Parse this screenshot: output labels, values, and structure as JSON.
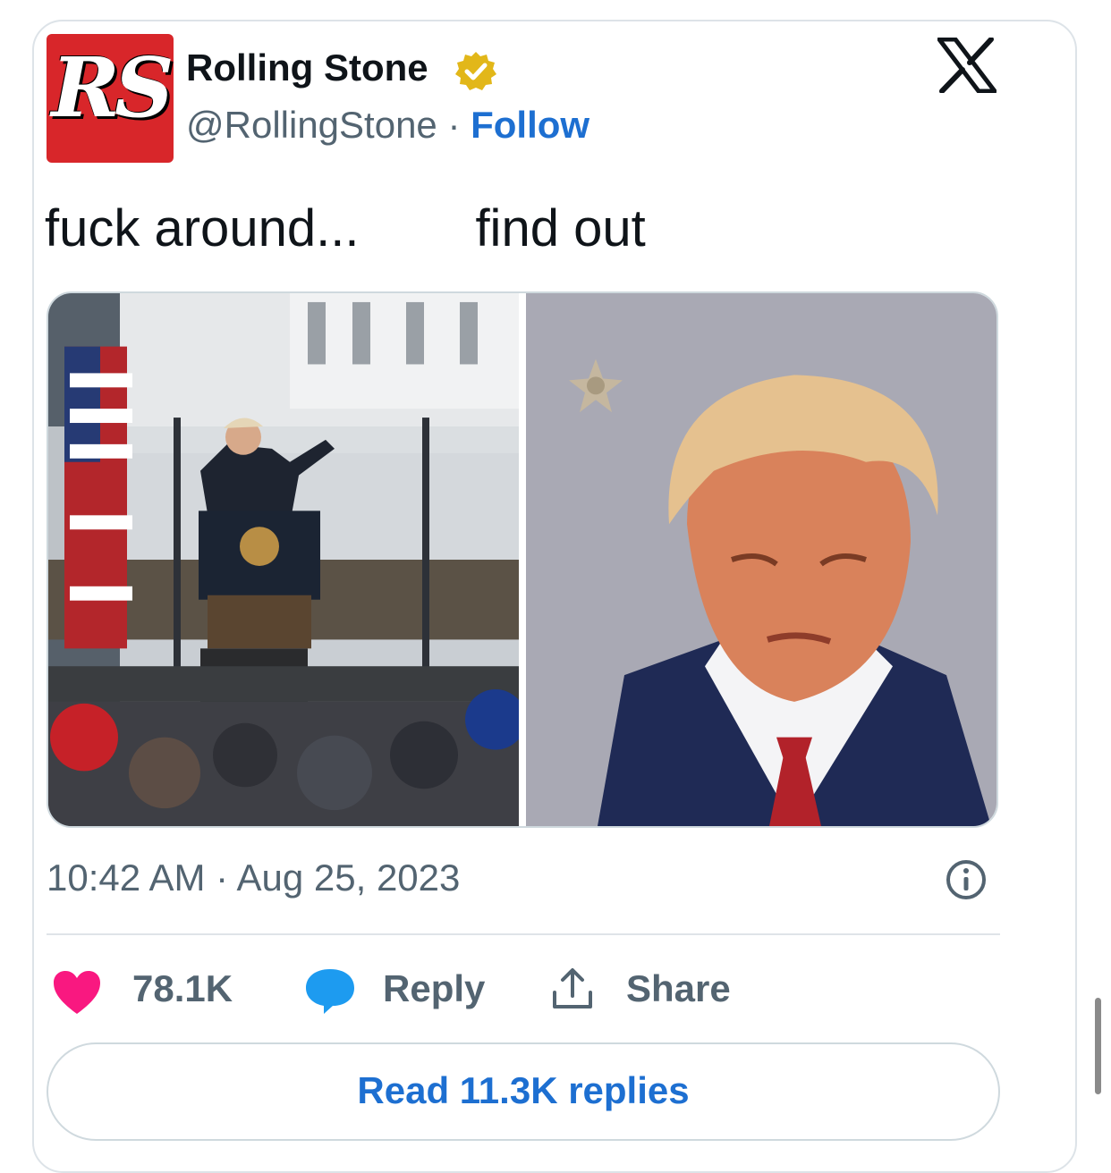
{
  "header": {
    "avatar_text": "RS",
    "name": "Rolling Stone",
    "handle": "@RollingStone",
    "separator": " · ",
    "follow_label": "Follow"
  },
  "tweet": {
    "text_part1": "fuck around...",
    "text_part2": "find out"
  },
  "media": {
    "left_image": "rally speech at podium with flags",
    "right_image": "booking photo against gray background"
  },
  "meta": {
    "time": "10:42 AM",
    "separator": " · ",
    "date": "Aug 25, 2023"
  },
  "actions": {
    "likes": "78.1K",
    "reply_label": "Reply",
    "share_label": "Share"
  },
  "footer": {
    "read_replies_label": "Read 11.3K replies"
  },
  "colors": {
    "brand_red": "#d8262a",
    "link_blue": "#1d6fd1",
    "heart_pink": "#f91880",
    "bubble_blue": "#1d9bf0",
    "verified_gold": "#e2b719"
  },
  "icons": [
    "verified-badge-icon",
    "x-logo-icon",
    "info-icon",
    "heart-icon",
    "reply-bubble-icon",
    "share-icon"
  ]
}
